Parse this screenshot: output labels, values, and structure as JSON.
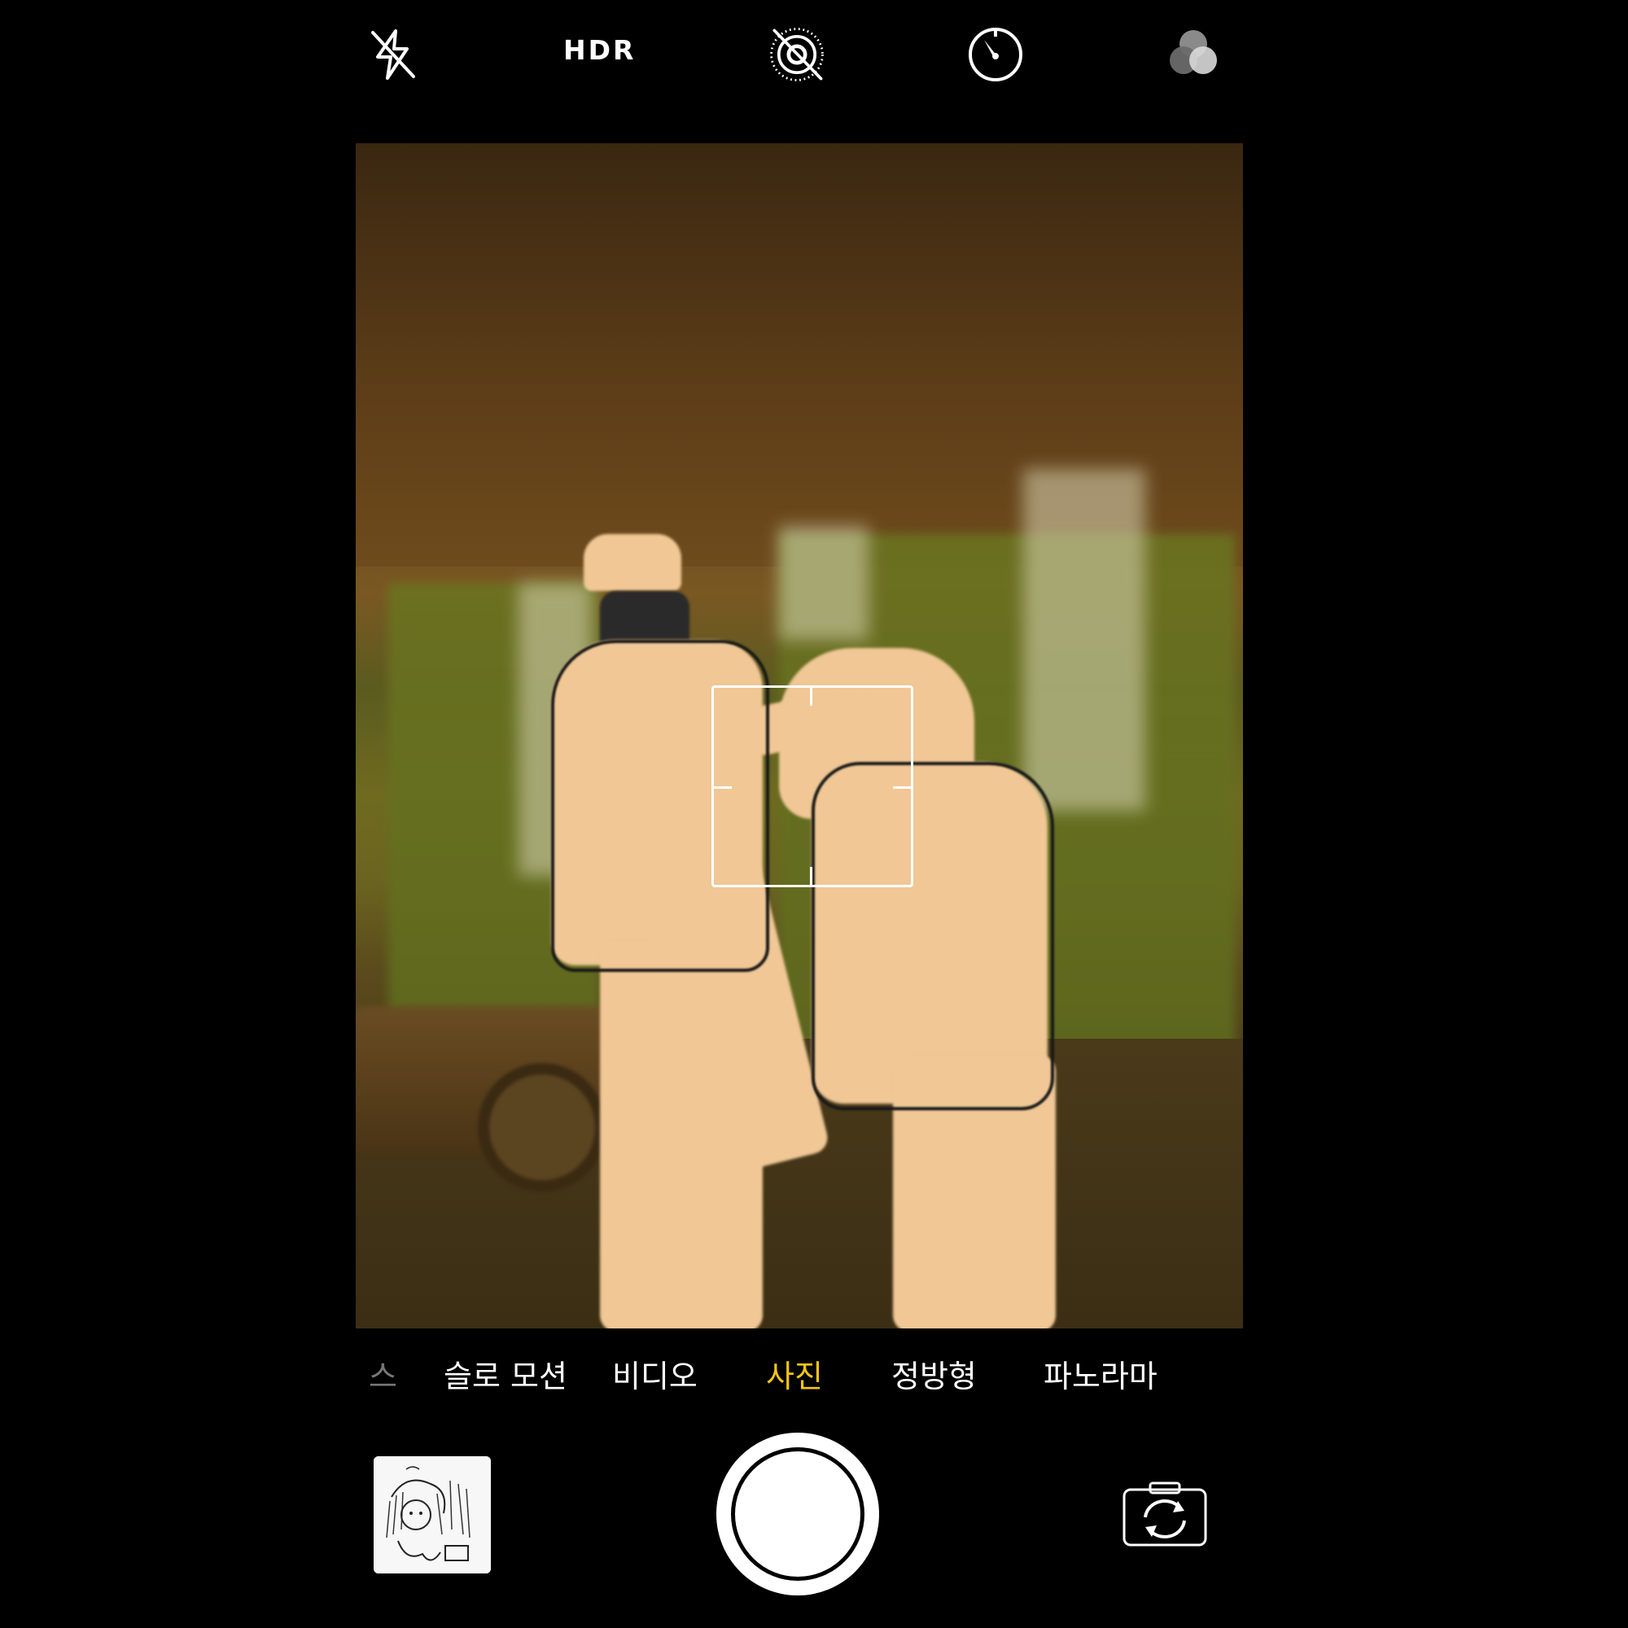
{
  "top_bar": {
    "flash_icon": "flash-off-icon",
    "hdr_label": "HDR",
    "live_photo_icon": "live-photo-off-icon",
    "timer_icon": "timer-icon",
    "filters_icon": "filters-icon"
  },
  "modes": {
    "items": [
      {
        "label": "스",
        "state": "faded"
      },
      {
        "label": "슬로 모션",
        "state": "normal"
      },
      {
        "label": "비디오",
        "state": "normal"
      },
      {
        "label": "사진",
        "state": "active"
      },
      {
        "label": "정방형",
        "state": "normal"
      },
      {
        "label": "파노라마",
        "state": "normal"
      }
    ],
    "active_color": "#f5c518"
  },
  "bottom_bar": {
    "thumbnail_icon": "last-photo-thumbnail",
    "shutter_icon": "shutter-button",
    "flip_icon": "camera-flip-icon"
  }
}
